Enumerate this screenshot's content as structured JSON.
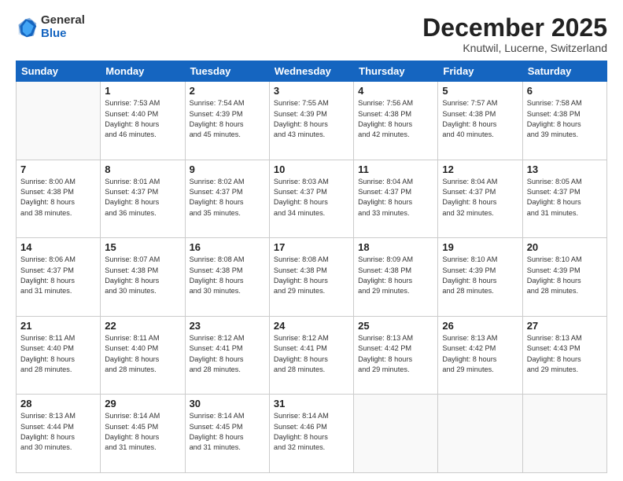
{
  "header": {
    "logo": {
      "general": "General",
      "blue": "Blue"
    },
    "title": "December 2025",
    "location": "Knutwil, Lucerne, Switzerland"
  },
  "days_of_week": [
    "Sunday",
    "Monday",
    "Tuesday",
    "Wednesday",
    "Thursday",
    "Friday",
    "Saturday"
  ],
  "weeks": [
    [
      {
        "day": "",
        "info": ""
      },
      {
        "day": "1",
        "info": "Sunrise: 7:53 AM\nSunset: 4:40 PM\nDaylight: 8 hours\nand 46 minutes."
      },
      {
        "day": "2",
        "info": "Sunrise: 7:54 AM\nSunset: 4:39 PM\nDaylight: 8 hours\nand 45 minutes."
      },
      {
        "day": "3",
        "info": "Sunrise: 7:55 AM\nSunset: 4:39 PM\nDaylight: 8 hours\nand 43 minutes."
      },
      {
        "day": "4",
        "info": "Sunrise: 7:56 AM\nSunset: 4:38 PM\nDaylight: 8 hours\nand 42 minutes."
      },
      {
        "day": "5",
        "info": "Sunrise: 7:57 AM\nSunset: 4:38 PM\nDaylight: 8 hours\nand 40 minutes."
      },
      {
        "day": "6",
        "info": "Sunrise: 7:58 AM\nSunset: 4:38 PM\nDaylight: 8 hours\nand 39 minutes."
      }
    ],
    [
      {
        "day": "7",
        "info": "Sunrise: 8:00 AM\nSunset: 4:38 PM\nDaylight: 8 hours\nand 38 minutes."
      },
      {
        "day": "8",
        "info": "Sunrise: 8:01 AM\nSunset: 4:37 PM\nDaylight: 8 hours\nand 36 minutes."
      },
      {
        "day": "9",
        "info": "Sunrise: 8:02 AM\nSunset: 4:37 PM\nDaylight: 8 hours\nand 35 minutes."
      },
      {
        "day": "10",
        "info": "Sunrise: 8:03 AM\nSunset: 4:37 PM\nDaylight: 8 hours\nand 34 minutes."
      },
      {
        "day": "11",
        "info": "Sunrise: 8:04 AM\nSunset: 4:37 PM\nDaylight: 8 hours\nand 33 minutes."
      },
      {
        "day": "12",
        "info": "Sunrise: 8:04 AM\nSunset: 4:37 PM\nDaylight: 8 hours\nand 32 minutes."
      },
      {
        "day": "13",
        "info": "Sunrise: 8:05 AM\nSunset: 4:37 PM\nDaylight: 8 hours\nand 31 minutes."
      }
    ],
    [
      {
        "day": "14",
        "info": "Sunrise: 8:06 AM\nSunset: 4:37 PM\nDaylight: 8 hours\nand 31 minutes."
      },
      {
        "day": "15",
        "info": "Sunrise: 8:07 AM\nSunset: 4:38 PM\nDaylight: 8 hours\nand 30 minutes."
      },
      {
        "day": "16",
        "info": "Sunrise: 8:08 AM\nSunset: 4:38 PM\nDaylight: 8 hours\nand 30 minutes."
      },
      {
        "day": "17",
        "info": "Sunrise: 8:08 AM\nSunset: 4:38 PM\nDaylight: 8 hours\nand 29 minutes."
      },
      {
        "day": "18",
        "info": "Sunrise: 8:09 AM\nSunset: 4:38 PM\nDaylight: 8 hours\nand 29 minutes."
      },
      {
        "day": "19",
        "info": "Sunrise: 8:10 AM\nSunset: 4:39 PM\nDaylight: 8 hours\nand 28 minutes."
      },
      {
        "day": "20",
        "info": "Sunrise: 8:10 AM\nSunset: 4:39 PM\nDaylight: 8 hours\nand 28 minutes."
      }
    ],
    [
      {
        "day": "21",
        "info": "Sunrise: 8:11 AM\nSunset: 4:40 PM\nDaylight: 8 hours\nand 28 minutes."
      },
      {
        "day": "22",
        "info": "Sunrise: 8:11 AM\nSunset: 4:40 PM\nDaylight: 8 hours\nand 28 minutes."
      },
      {
        "day": "23",
        "info": "Sunrise: 8:12 AM\nSunset: 4:41 PM\nDaylight: 8 hours\nand 28 minutes."
      },
      {
        "day": "24",
        "info": "Sunrise: 8:12 AM\nSunset: 4:41 PM\nDaylight: 8 hours\nand 28 minutes."
      },
      {
        "day": "25",
        "info": "Sunrise: 8:13 AM\nSunset: 4:42 PM\nDaylight: 8 hours\nand 29 minutes."
      },
      {
        "day": "26",
        "info": "Sunrise: 8:13 AM\nSunset: 4:42 PM\nDaylight: 8 hours\nand 29 minutes."
      },
      {
        "day": "27",
        "info": "Sunrise: 8:13 AM\nSunset: 4:43 PM\nDaylight: 8 hours\nand 29 minutes."
      }
    ],
    [
      {
        "day": "28",
        "info": "Sunrise: 8:13 AM\nSunset: 4:44 PM\nDaylight: 8 hours\nand 30 minutes."
      },
      {
        "day": "29",
        "info": "Sunrise: 8:14 AM\nSunset: 4:45 PM\nDaylight: 8 hours\nand 31 minutes."
      },
      {
        "day": "30",
        "info": "Sunrise: 8:14 AM\nSunset: 4:45 PM\nDaylight: 8 hours\nand 31 minutes."
      },
      {
        "day": "31",
        "info": "Sunrise: 8:14 AM\nSunset: 4:46 PM\nDaylight: 8 hours\nand 32 minutes."
      },
      {
        "day": "",
        "info": ""
      },
      {
        "day": "",
        "info": ""
      },
      {
        "day": "",
        "info": ""
      }
    ]
  ]
}
